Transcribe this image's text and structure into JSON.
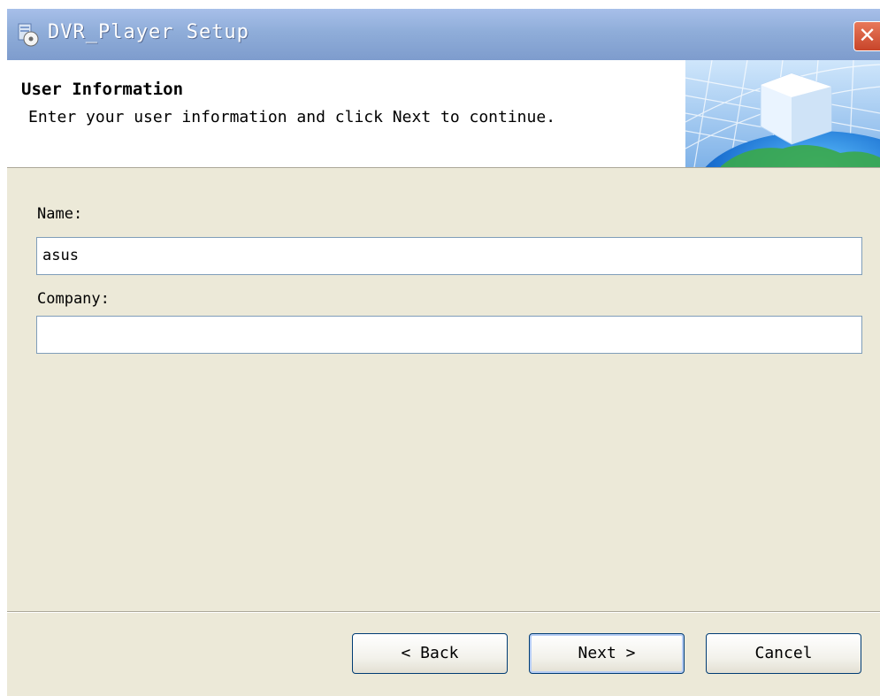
{
  "window": {
    "title": "DVR_Player Setup",
    "close_glyph": "✕",
    "icon": "setup-disc-icon"
  },
  "header": {
    "title": "User Information",
    "subtitle": "Enter your user information and click Next to continue.",
    "art_icon": "globe-cube-banner"
  },
  "form": {
    "name_label": "Name:",
    "name_value": "asus",
    "company_label": "Company:",
    "company_value": ""
  },
  "buttons": {
    "back": "< Back",
    "next": "Next >",
    "cancel": "Cancel"
  },
  "colors": {
    "titlebar": "#8fadd9",
    "dialog_bg": "#ece9d8",
    "close": "#c8452a",
    "input_border": "#7f9db9"
  }
}
